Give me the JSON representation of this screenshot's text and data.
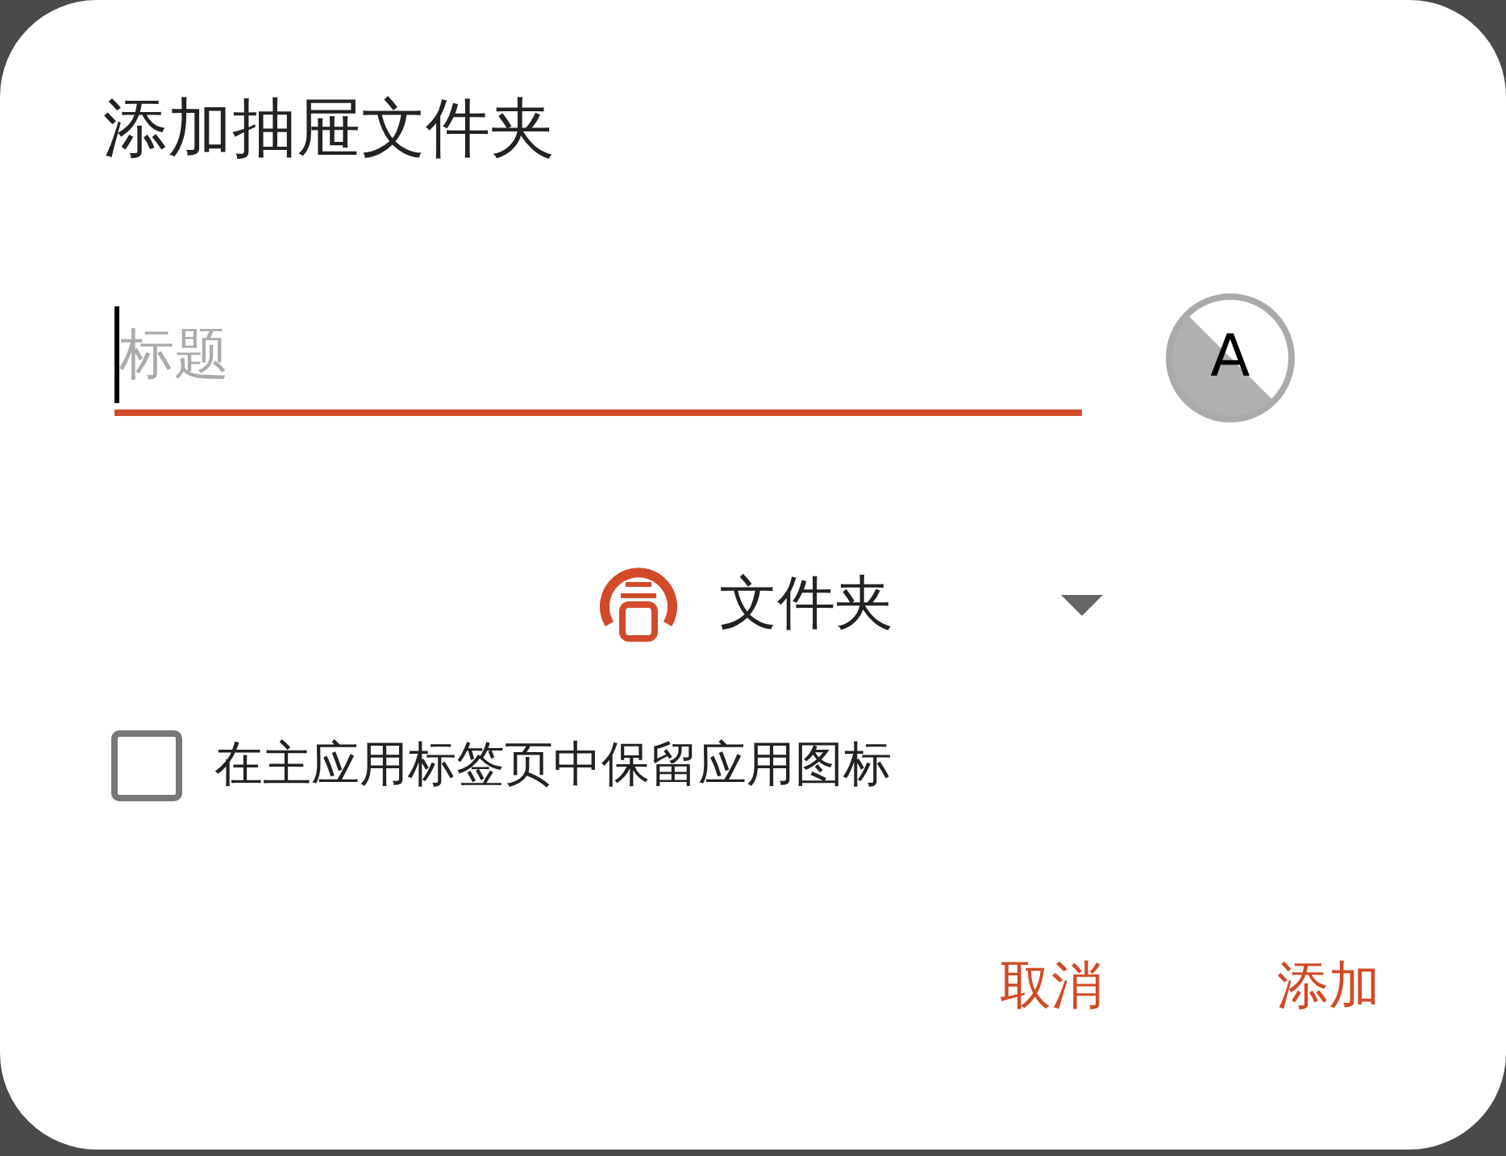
{
  "dialog": {
    "title": "添加抽屉文件夹",
    "title_field": {
      "placeholder": "标题",
      "focused": true
    },
    "icon_button": {
      "letter": "A"
    },
    "type_dropdown": {
      "value": "文件夹"
    },
    "keep_icon_checkbox": {
      "label": "在主应用标签页中保留应用图标",
      "checked": false
    },
    "buttons": [
      {
        "label": "取消"
      },
      {
        "label": "添加"
      }
    ]
  }
}
